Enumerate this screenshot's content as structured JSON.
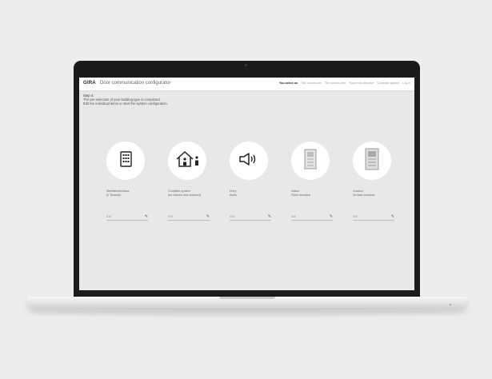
{
  "app": {
    "logo": "GIRA",
    "title": "Door communication configurator"
  },
  "nav": {
    "items": [
      {
        "label": "You select on",
        "active": true
      },
      {
        "label": "The Scenes use",
        "active": false
      },
      {
        "label": "The scenes next",
        "active": false
      },
      {
        "label": "Room tion describe",
        "active": false
      },
      {
        "label": "Complete system",
        "active": false
      },
      {
        "label": "Log in",
        "active": false
      }
    ]
  },
  "intro": {
    "step": "Step 4:",
    "line1": "The pre-selection of your building type is completed.",
    "line2": "Edit the individual items or start the system configuration."
  },
  "cards": [
    {
      "icon": "apartment-building-icon",
      "label_line1": "Mehrfamilienhaus",
      "label_line2": "(2 Tenants)",
      "foot": "Edit"
    },
    {
      "icon": "house-with-person-icon",
      "label_line1": "Complete system",
      "label_line2": "(for indoors and outdoors)",
      "foot": "Edit"
    },
    {
      "icon": "speaker-icon",
      "label_line1": "Entry",
      "label_line2": "Audio",
      "foot": "Edit"
    },
    {
      "icon": "flush-door-station-icon",
      "label_line1": "Indoor",
      "label_line2": "Flush mounted",
      "foot": "Edit"
    },
    {
      "icon": "surface-door-station-icon",
      "label_line1": "Outdoor",
      "label_line2": "Surface mounted",
      "foot": "Edit"
    }
  ],
  "colors": {
    "background": "#ededed",
    "screen": "#e8e8e6",
    "bezel": "#1b1b1b"
  }
}
